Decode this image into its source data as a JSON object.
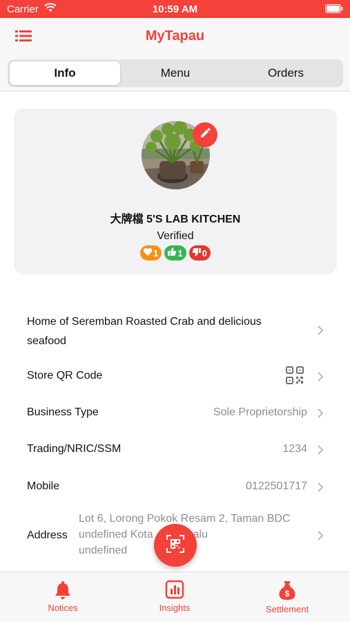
{
  "status_bar": {
    "carrier": "Carrier",
    "time": "10:59 AM"
  },
  "header": {
    "title": "MyTapau",
    "menu_icon": "list-icon"
  },
  "tabs": [
    {
      "label": "Info",
      "active": true
    },
    {
      "label": "Menu",
      "active": false
    },
    {
      "label": "Orders",
      "active": false
    }
  ],
  "profile": {
    "store_name": "大牌檔 5'S LAB KITCHEN",
    "status": "Verified",
    "edit_icon": "pencil-icon",
    "ratings": {
      "love": "1",
      "like": "1",
      "dislike": "0"
    }
  },
  "details": {
    "description": "Home of Seremban Roasted Crab and delicious seafood",
    "qr_label": "Store QR Code",
    "business_type_label": "Business Type",
    "business_type_value": "Sole Proprietorship",
    "trading_label": "Trading/NRIC/SSM",
    "trading_value": "1234",
    "mobile_label": "Mobile",
    "mobile_value": "0122501717",
    "address_label": "Address",
    "address_line1": "Lot 6, Lorong Pokok Resam 2, Taman BDC",
    "address_line2": "undefined Kota",
    "address_line2_tail": "alu",
    "address_line3": "undefined"
  },
  "fab": {
    "icon": "qr-scan-icon"
  },
  "bottom_tabs": [
    {
      "label": "Notices",
      "icon": "bell-icon"
    },
    {
      "label": "Insights",
      "icon": "bar-chart-icon"
    },
    {
      "label": "Settlement",
      "icon": "money-bag-icon"
    }
  ],
  "colors": {
    "accent": "#f4413a",
    "love": "#f29318",
    "like": "#35b552",
    "dislike": "#e8352e"
  }
}
